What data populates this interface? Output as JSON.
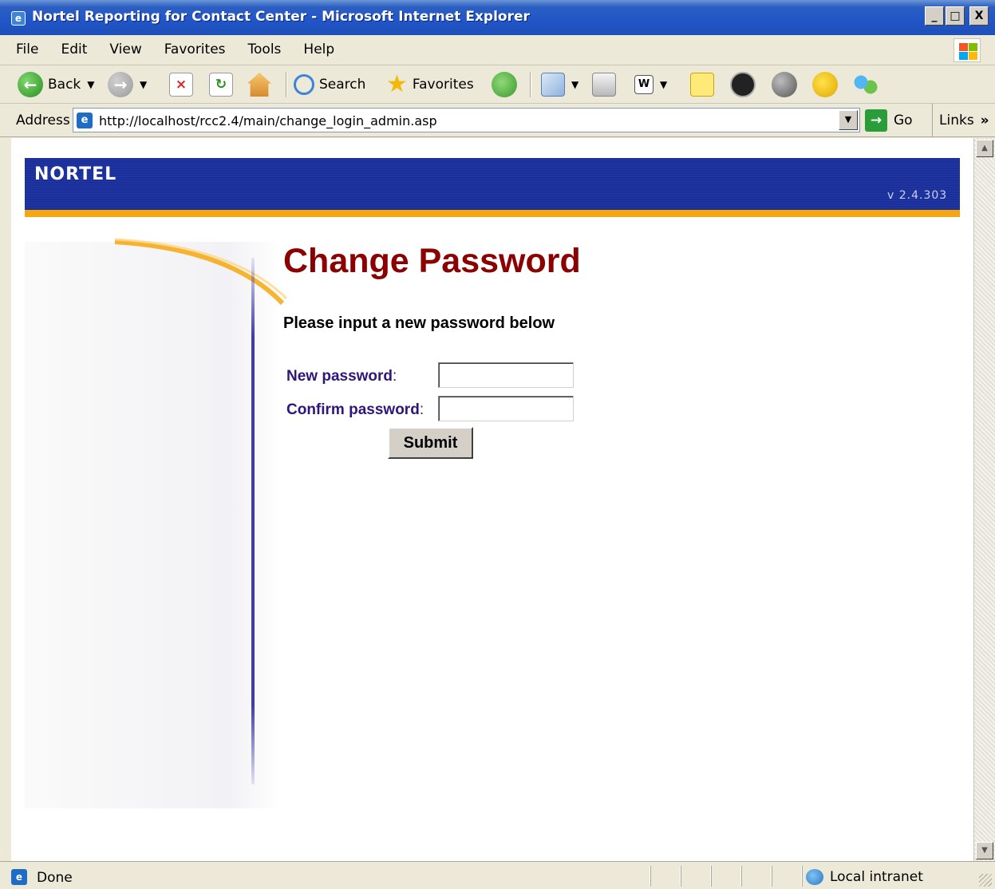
{
  "window": {
    "title": "Nortel Reporting for Contact Center - Microsoft Internet Explorer",
    "minimize": "_",
    "maximize": "□",
    "close": "X"
  },
  "menu": {
    "items": [
      "File",
      "Edit",
      "View",
      "Favorites",
      "Tools",
      "Help"
    ]
  },
  "toolbar": {
    "back_label": "Back",
    "search_label": "Search",
    "favorites_label": "Favorites"
  },
  "address": {
    "label": "Address",
    "url": "http://localhost/rcc2.4/main/change_login_admin.asp",
    "go_label": "Go",
    "links_label": "Links"
  },
  "page": {
    "logo": "NORTEL",
    "version": "v 2.4.303",
    "title": "Change Password",
    "subtitle": "Please input a new password below",
    "new_password_label": "New password",
    "confirm_password_label": "Confirm password",
    "colon": ":",
    "new_password_value": "",
    "confirm_password_value": "",
    "submit_label": "Submit"
  },
  "status": {
    "text": "Done",
    "zone": "Local intranet"
  },
  "colors": {
    "banner_blue": "#1b2f9c",
    "banner_orange": "#f4a70e",
    "title_red": "#8b0000",
    "label_purple": "#30157a"
  }
}
